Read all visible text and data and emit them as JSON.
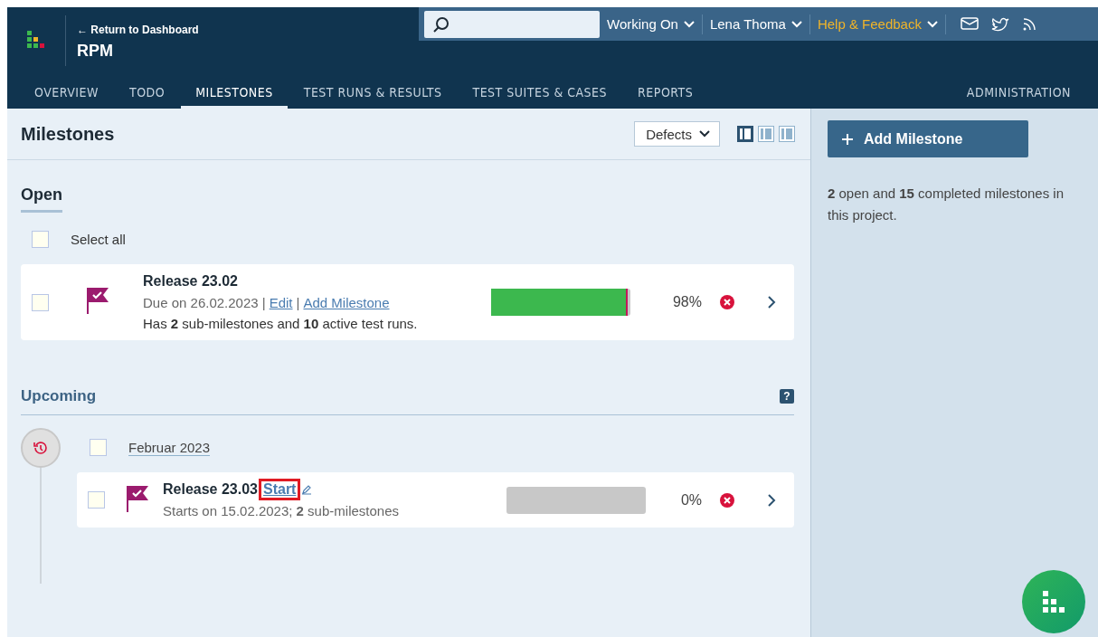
{
  "header": {
    "back_link": "← Return to Dashboard",
    "project": "RPM",
    "menus": [
      {
        "label": "Working On",
        "kind": "menu"
      },
      {
        "label": "Lena Thoma",
        "kind": "menu"
      },
      {
        "label": "Help & Feedback",
        "kind": "help"
      }
    ]
  },
  "tabs": [
    {
      "label": "OVERVIEW",
      "selected": false
    },
    {
      "label": "TODO",
      "selected": false
    },
    {
      "label": "MILESTONES",
      "selected": true
    },
    {
      "label": "TEST RUNS & RESULTS",
      "selected": false
    },
    {
      "label": "TEST SUITES & CASES",
      "selected": false
    },
    {
      "label": "REPORTS",
      "selected": false
    }
  ],
  "admin_tab": {
    "label": "ADMINISTRATION",
    "selected": false
  },
  "page_title": "Milestones",
  "filter": "Defects",
  "views": [
    {
      "selected": true
    },
    {
      "selected": false
    },
    {
      "selected": false
    }
  ],
  "open": {
    "title": "Open",
    "select_all": {
      "label": "Select all",
      "checked": false
    },
    "milestones": [
      {
        "title": "Release 23.02",
        "checked": false,
        "parts": [
          {
            "kind": "text",
            "text": "Due on 26.02.2023 |"
          },
          {
            "kind": "link",
            "text": "Edit"
          },
          {
            "kind": "text",
            "text": "|"
          },
          {
            "kind": "link",
            "text": "Add Milestone"
          }
        ],
        "summary": "Has **2** sub-milestones and **10** active test runs.",
        "level": 0.98,
        "percent": "98%"
      }
    ]
  },
  "upcoming": {
    "title": "Upcoming",
    "help": "?",
    "groups": [
      {
        "label": "Februar 2023",
        "checked": false,
        "milestones": [
          {
            "title": "Release 23.03",
            "checked": false,
            "start_link": "Start",
            "highlighted": true,
            "summary": "Starts on 15.02.2023; **2** sub-milestones",
            "level": 0,
            "percent": "0%"
          }
        ]
      }
    ]
  },
  "sidebar": {
    "button": "Add Milestone",
    "text": "**2** open and **15** completed milestones in this project."
  }
}
